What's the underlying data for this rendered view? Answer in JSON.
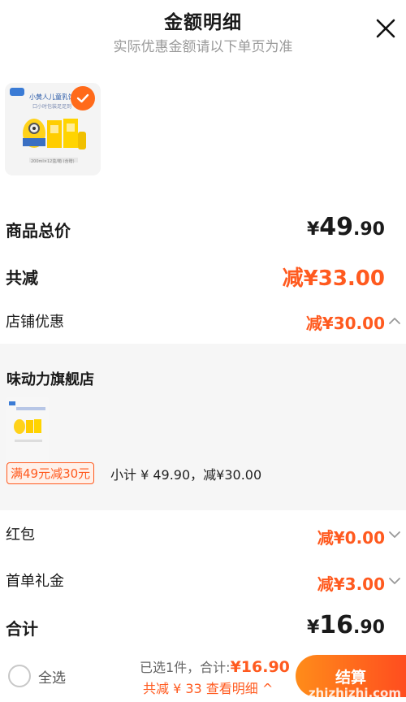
{
  "header": {
    "title": "金额明细",
    "subtitle": "实际优惠金额请以下单页为准"
  },
  "product": {
    "brand_text": "小黄人儿童乳饮料",
    "sub_text": "口小时包装足足到",
    "footer_text": "200ml×12盒/箱 (含赠)"
  },
  "summary": {
    "total_label": "商品总价",
    "total_currency": "¥",
    "total_int": "49",
    "total_dec": ".90",
    "reduce_label": "共减",
    "reduce_value": "减¥33.00",
    "shop_discount_label": "店铺优惠",
    "shop_discount_value": "减¥30.00"
  },
  "shop": {
    "name": "味动力旗舰店",
    "promo_tag": "满49元减30元",
    "subtotal": "小计 ¥ 49.90，减¥30.00"
  },
  "extras": {
    "redpacket_label": "红包",
    "redpacket_value": "减¥0.00",
    "firstorder_label": "首单礼金",
    "firstorder_value": "减¥3.00",
    "grand_label": "合计",
    "grand_currency": "¥",
    "grand_int": "16",
    "grand_dec": ".90"
  },
  "bottom": {
    "select_all": "全选",
    "selected_prefix": "已选1件，合计:",
    "selected_amount": "¥16.90",
    "reduce_detail": "共减 ¥ 33  查看明细 ^",
    "checkout": "结算",
    "watermark": "zhizhizhi.com"
  },
  "colors": {
    "accent": "#ff5a1f",
    "muted": "#9a9a9a"
  }
}
